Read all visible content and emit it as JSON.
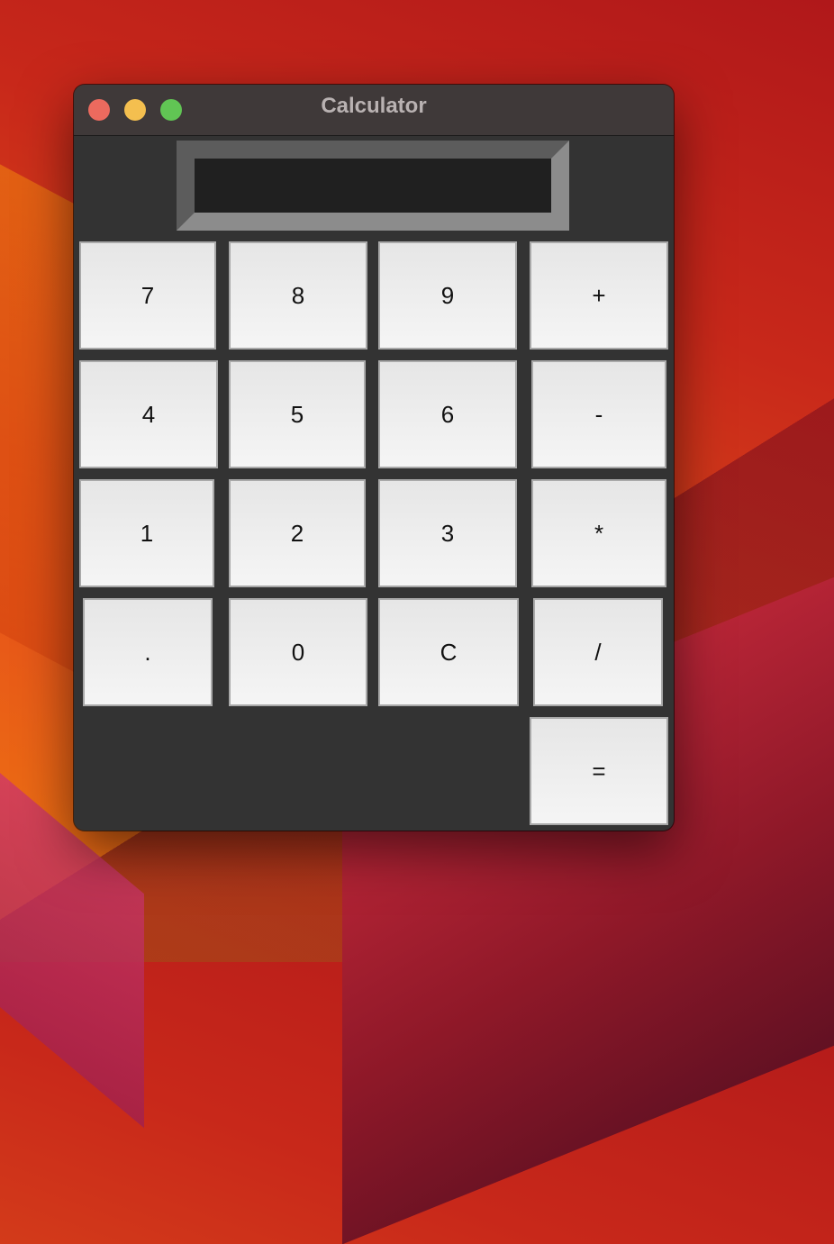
{
  "window": {
    "title": "Calculator"
  },
  "display": {
    "value": ""
  },
  "keys": {
    "k7": "7",
    "k8": "8",
    "k9": "9",
    "plus": "+",
    "k4": "4",
    "k5": "5",
    "k6": "6",
    "minus": "-",
    "k1": "1",
    "k2": "2",
    "k3": "3",
    "multiply": "*",
    "dot": ".",
    "k0": "0",
    "clear": "C",
    "divide": "/",
    "equals": "="
  }
}
